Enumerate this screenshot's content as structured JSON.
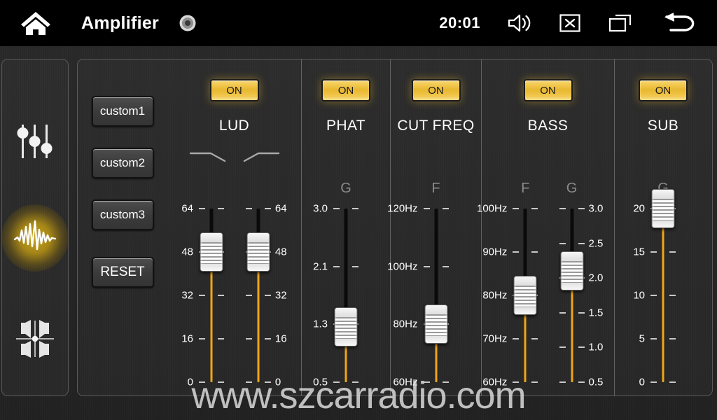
{
  "topbar": {
    "title": "Amplifier",
    "clock": "20:01",
    "home_icon": "home-icon",
    "disc_icon": "disc-icon",
    "volume_icon": "volume-icon",
    "close_icon": "close-box-icon",
    "recents_icon": "recent-apps-icon",
    "back_icon": "back-arrow-icon"
  },
  "sidebar": {
    "items": [
      {
        "name": "equalizer",
        "icon": "equalizer-sliders-icon",
        "active": false
      },
      {
        "name": "amplifier",
        "icon": "waveform-icon",
        "active": true
      },
      {
        "name": "balance-fader",
        "icon": "speaker-fader-icon",
        "active": false
      }
    ]
  },
  "presets": {
    "buttons": [
      {
        "label": "custom1"
      },
      {
        "label": "custom2"
      },
      {
        "label": "custom3"
      },
      {
        "label": "RESET"
      }
    ]
  },
  "channels": [
    {
      "id": "lud",
      "title": "LUD",
      "on_label": "ON",
      "on_state": true,
      "curve_icons": [
        "lowpass-curve-icon",
        "highpass-curve-icon"
      ],
      "sliders": [
        {
          "id": "lud-low",
          "sub_label": "",
          "label_side": "left",
          "scale": [
            "64",
            "48",
            "32",
            "16",
            "0"
          ],
          "value": 48,
          "min": 0,
          "max": 64
        },
        {
          "id": "lud-high",
          "sub_label": "",
          "label_side": "right",
          "scale": [
            "64",
            "48",
            "32",
            "16",
            "0"
          ],
          "value": 48,
          "min": 0,
          "max": 64
        }
      ]
    },
    {
      "id": "phat",
      "title": "PHAT",
      "on_label": "ON",
      "on_state": true,
      "curve_icons": [],
      "sliders": [
        {
          "id": "phat-gain",
          "sub_label": "G",
          "label_side": "left",
          "scale": [
            "3.0",
            "2.1",
            "1.3",
            "0.5"
          ],
          "value": 1.3,
          "min": 0.5,
          "max": 3.0
        }
      ]
    },
    {
      "id": "cutfreq",
      "title": "CUT FREQ",
      "on_label": "ON",
      "on_state": true,
      "curve_icons": [],
      "sliders": [
        {
          "id": "cutfreq-f",
          "sub_label": "F",
          "label_side": "left",
          "scale": [
            "120Hz",
            "100Hz",
            "80Hz",
            "60Hz"
          ],
          "value": 80,
          "min": 60,
          "max": 120
        }
      ]
    },
    {
      "id": "bass",
      "title": "BASS",
      "on_label": "ON",
      "on_state": true,
      "curve_icons": [],
      "sliders": [
        {
          "id": "bass-f",
          "sub_label": "F",
          "label_side": "left",
          "scale": [
            "100Hz",
            "90Hz",
            "80Hz",
            "70Hz",
            "60Hz"
          ],
          "value": 80,
          "min": 60,
          "max": 100
        },
        {
          "id": "bass-g",
          "sub_label": "G",
          "label_side": "right",
          "scale": [
            "3.0",
            "2.5",
            "2.0",
            "1.5",
            "1.0",
            "0.5"
          ],
          "value": 2.1,
          "min": 0.5,
          "max": 3.0
        }
      ]
    },
    {
      "id": "sub",
      "title": "SUB",
      "on_label": "ON",
      "on_state": true,
      "curve_icons": [],
      "sliders": [
        {
          "id": "sub-gain",
          "sub_label": "G",
          "label_side": "left",
          "scale": [
            "20",
            "15",
            "10",
            "5",
            "0"
          ],
          "value": 20,
          "min": 0,
          "max": 20
        }
      ]
    }
  ],
  "watermark": "www.szcarradio.com",
  "colors": {
    "accent": "#f0a516",
    "on_button": "#e8b830",
    "active_glow": "#d6ae19",
    "panel_bg": "#2b2b2b",
    "text": "#ffffff"
  }
}
